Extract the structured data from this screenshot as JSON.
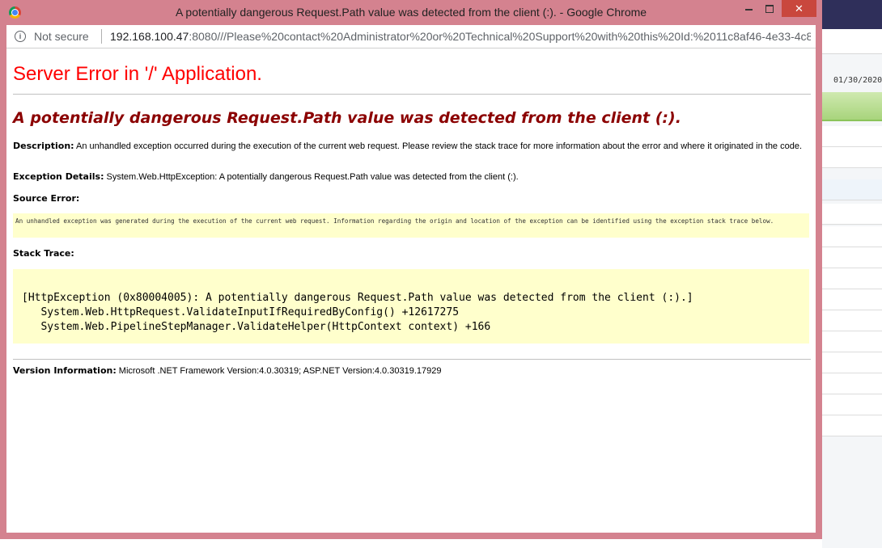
{
  "window": {
    "title": "A potentially dangerous Request.Path value was detected from the client (:). - Google Chrome",
    "close_glyph": "✕"
  },
  "addressbar": {
    "security_label": "Not secure",
    "url_host": "192.168.100.47",
    "url_rest": ":8080///Please%20contact%20Administrator%20or%20Technical%20Support%20with%20this%20Id:%2011c8af46-4e33-4c8..."
  },
  "page": {
    "heading": "Server Error in '/' Application.",
    "subheading": "A potentially dangerous Request.Path value was detected from the client (:).",
    "description_label": "Description:",
    "description_text": " An unhandled exception occurred during the execution of the current web request. Please review the stack trace for more information about the error and where it originated in the code.",
    "exception_label": "Exception Details:",
    "exception_text": " System.Web.HttpException: A potentially dangerous Request.Path value was detected from the client (:).",
    "source_error_label": "Source Error:",
    "source_error_text": "An unhandled exception was generated during the execution of the current web request. Information regarding the origin and location of the exception can be identified using the exception stack trace below.",
    "stack_trace_label": "Stack Trace:",
    "stack_lines": [
      "[HttpException (0x80004005): A potentially dangerous Request.Path value was detected from the client (:).]",
      "   System.Web.HttpRequest.ValidateInputIfRequiredByConfig() +12617275",
      "   System.Web.PipelineStepManager.ValidateHelper(HttpContext context) +166"
    ],
    "version_label": "Version Information:",
    "version_text": " Microsoft .NET Framework Version:4.0.30319; ASP.NET Version:4.0.30319.17929"
  },
  "background_app": {
    "date": "01/30/2020"
  },
  "colors": {
    "window_frame": "#d4828f",
    "heading_red": "#ff0000",
    "subheading_maroon": "#8b0000",
    "code_background": "#ffffcc",
    "close_button": "#c9473d"
  }
}
